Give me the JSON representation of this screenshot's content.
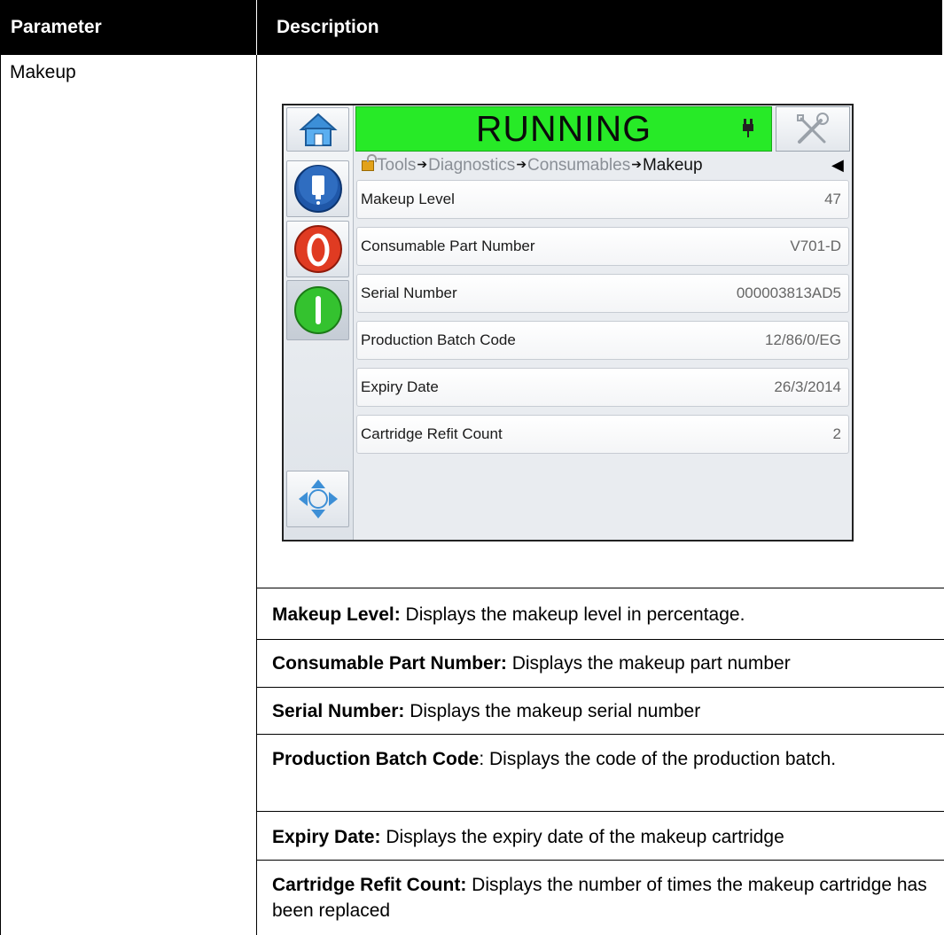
{
  "table": {
    "header": {
      "parameter": "Parameter",
      "description": "Description"
    },
    "parameter_name": "Makeup"
  },
  "device": {
    "status": "RUNNING",
    "status_color": "#27ea27",
    "icons": {
      "home": "home-icon",
      "print_head": "print-head-icon",
      "stop": "stop-icon",
      "start": "start-icon",
      "navigation": "navigation-arrows-icon",
      "tools": "tools-icon",
      "plug": "plug-icon",
      "lock": "lock-icon",
      "back": "back-arrow-icon"
    },
    "breadcrumb": [
      {
        "label": "Tools"
      },
      {
        "label": "Diagnostics"
      },
      {
        "label": "Consumables"
      },
      {
        "label": "Makeup"
      }
    ],
    "fields": [
      {
        "label": "Makeup Level",
        "value": "47"
      },
      {
        "label": "Consumable Part Number",
        "value": "V701-D"
      },
      {
        "label": "Serial Number",
        "value": "000003813AD5"
      },
      {
        "label": "Production Batch Code",
        "value": "12/86/0/EG"
      },
      {
        "label": "Expiry Date",
        "value": "26/3/2014"
      },
      {
        "label": "Cartridge Refit Count",
        "value": "2"
      }
    ]
  },
  "descriptions": [
    {
      "term": "Makeup Level:",
      "text": " Displays the makeup level in percentage."
    },
    {
      "term": "Consumable Part Number:",
      "text": " Displays the makeup part number"
    },
    {
      "term": "Serial Number:",
      "text": " Displays the makeup serial number"
    },
    {
      "term": "Production Batch Code",
      "text": ": Displays the code of the production batch."
    },
    {
      "term": "Expiry Date:",
      "text": " Displays the expiry date of the makeup cartridge"
    },
    {
      "term": "Cartridge Refit Count:",
      "text": " Displays the number of times the makeup cartridge has been replaced"
    }
  ]
}
